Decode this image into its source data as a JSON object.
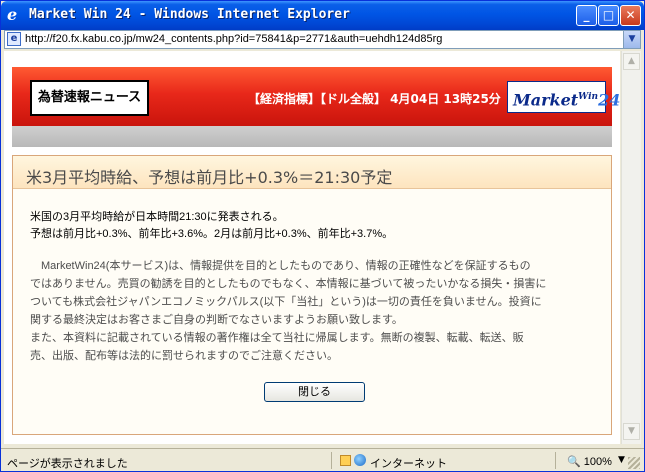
{
  "window": {
    "title": "Market Win 24 - Windows Internet Explorer"
  },
  "address_bar": {
    "url": "http://f20.fx.kabu.co.jp/mw24_contents.php?id=75841&p=2771&auth=uehdh124d85rg"
  },
  "header": {
    "news_label": "為替速報ニュース",
    "info": "【経済指標】【ドル全般】 4月04日 13時25分",
    "logo_prefix": "Market",
    "logo_win": "Win",
    "logo_num": "24"
  },
  "article": {
    "title": "米3月平均時給、予想は前月比+0.3%＝21:30予定",
    "body": [
      "米国の3月平均時給が日本時間21:30に発表される。",
      "予想は前月比+0.3%、前年比+3.6%。2月は前月比+0.3%、前年比+3.7%。"
    ],
    "disclaimer": [
      "　MarketWin24(本サービス)は、情報提供を目的としたものであり、情報の正確性などを保証するもの",
      "ではありません。売買の勧誘を目的としたものでもなく、本情報に基づいて被ったいかなる損失・損害に",
      "ついても株式会社ジャパンエコノミックパルス(以下「当社」という)は一切の責任を負いません。投資に",
      "関する最終決定はお客さまご自身の判断でなさいますようお願い致します。",
      "また、本資料に記載されている情報の著作権は全て当社に帰属します。無断の複製、転載、転送、販",
      "売、出版、配布等は法的に罰せられますのでご注意ください。"
    ],
    "close_button": "閉じる"
  },
  "status_bar": {
    "status": "ページが表示されました",
    "zone": "インターネット",
    "zoom": "100%"
  }
}
